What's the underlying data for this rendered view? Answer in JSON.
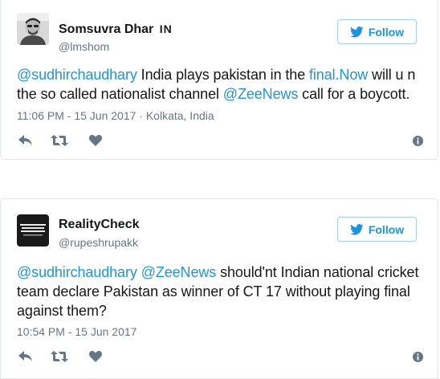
{
  "tweets": [
    {
      "author": {
        "name": "Somsuvra Dhar",
        "badge": "IN",
        "handle": "@lmshom"
      },
      "follow_label": "Follow",
      "text": [
        {
          "t": "@sudhirchaudhary",
          "link": true
        },
        {
          "t": " India plays pakistan in the ",
          "link": false
        },
        {
          "t": "final.Now",
          "link": true
        },
        {
          "t": " will u n the so called nationalist channel ",
          "link": false
        },
        {
          "t": "@ZeeNews",
          "link": true
        },
        {
          "t": " call for a boycott.",
          "link": false
        }
      ],
      "meta": "11:06 PM - 15 Jun 2017 · Kolkata, India"
    },
    {
      "author": {
        "name": "RealityCheck",
        "handle": "@rupeshrupakk",
        "avatar_text": "IT'S OK IF YOU DISAGREE WITH ME. I CAN'T FORCE YOU TO BE RIGHT."
      },
      "follow_label": "Follow",
      "text": [
        {
          "t": "@sudhirchaudhary",
          "link": true
        },
        {
          "t": " ",
          "link": false
        },
        {
          "t": "@ZeeNews",
          "link": true
        },
        {
          "t": " should'nt Indian national cricket team declare Pakistan as winner of CT 17 without playing final against them?",
          "link": false
        }
      ],
      "meta": "10:54 PM - 15 Jun 2017"
    }
  ],
  "colors": {
    "link": "#1b95e0",
    "text": "#14171a",
    "muted": "#657786",
    "border": "#e1e8ed",
    "follow_border": "#a3cff0"
  }
}
